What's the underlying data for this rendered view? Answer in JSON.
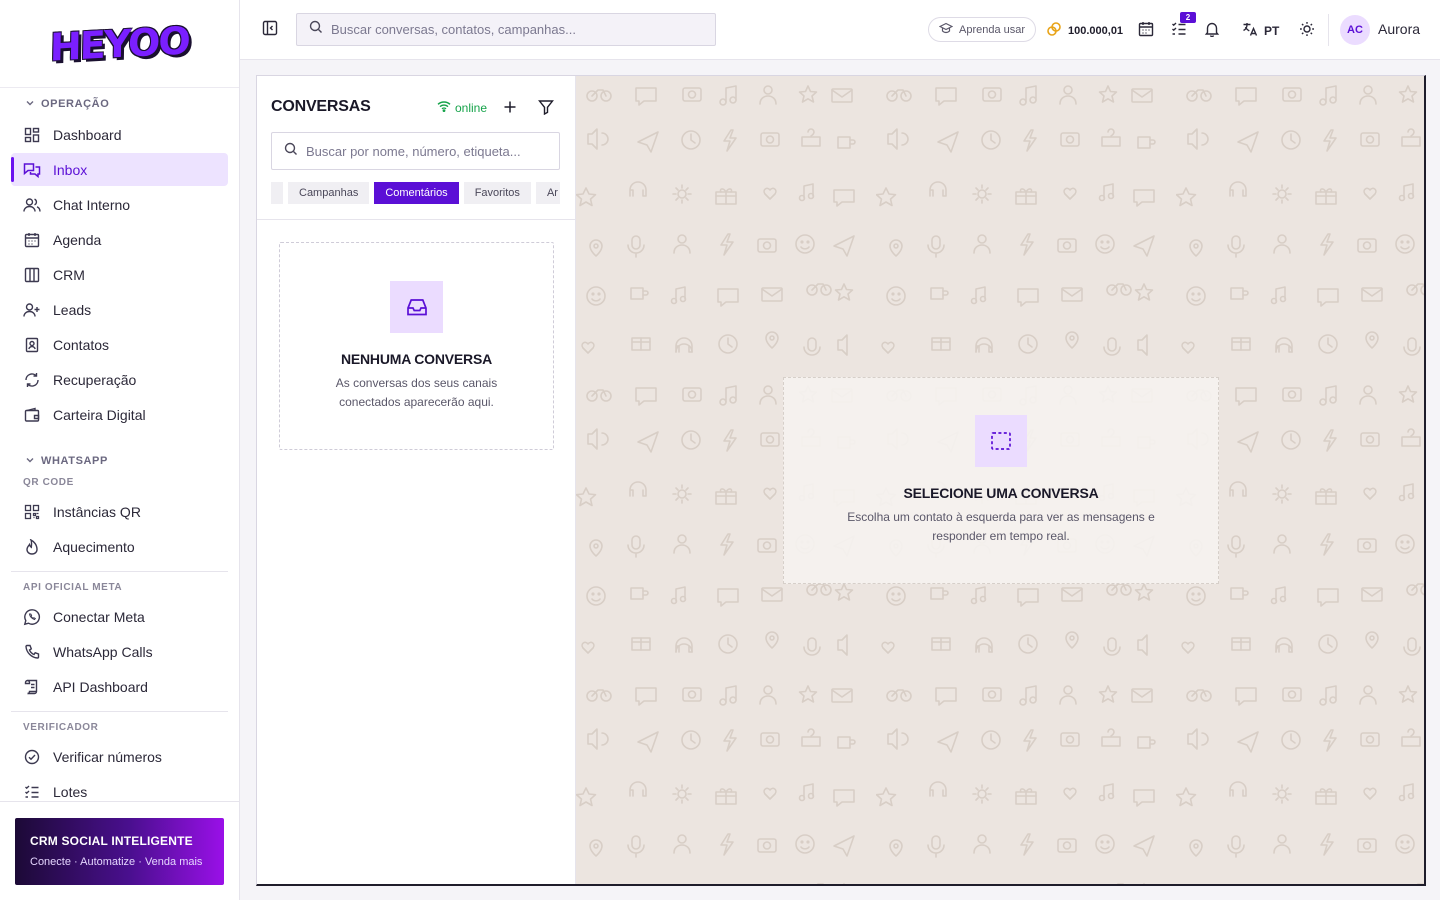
{
  "brand": {
    "logo_text": "HEYOO"
  },
  "sidebar": {
    "sections": {
      "operacao": "OPERAÇÃO",
      "whatsapp": "WHATSAPP",
      "qr_code": "QR CODE",
      "api_oficial": "API OFICIAL META",
      "verificador": "VERIFICADOR"
    },
    "items": {
      "dashboard": "Dashboard",
      "inbox": "Inbox",
      "chat_interno": "Chat Interno",
      "agenda": "Agenda",
      "crm": "CRM",
      "leads": "Leads",
      "contatos": "Contatos",
      "recuperacao": "Recuperação",
      "carteira": "Carteira Digital",
      "instancias_qr": "Instâncias QR",
      "aquecimento": "Aquecimento",
      "conectar_meta": "Conectar Meta",
      "whatsapp_calls": "WhatsApp Calls",
      "api_dashboard": "API Dashboard",
      "verificar_numeros": "Verificar números",
      "lotes": "Lotes"
    },
    "active_item": "inbox",
    "promo": {
      "title": "CRM SOCIAL INTELIGENTE",
      "subtitle": "Conecte · Automatize · Venda mais"
    }
  },
  "topbar": {
    "search_placeholder": "Buscar conversas, contatos, campanhas...",
    "learn_label": "Aprenda usar",
    "credits": "100.000,01",
    "tasks_badge": "2",
    "language": "PT",
    "user_initials": "AC",
    "user_name": "Aurora"
  },
  "conversations": {
    "title": "CONVERSAS",
    "status": "online",
    "search_placeholder": "Buscar por nome, número, etiqueta...",
    "tabs": [
      "Campanhas",
      "Comentários",
      "Favoritos",
      "Ar"
    ],
    "active_tab": 1,
    "empty": {
      "title": "NENHUMA CONVERSA",
      "subtitle": "As conversas dos seus canais conectados aparecerão aqui."
    }
  },
  "chat": {
    "empty": {
      "title": "SELECIONE UMA CONVERSA",
      "subtitle": "Escolha um contato à esquerda para ver as mensagens e responder em tempo real."
    }
  },
  "colors": {
    "accent": "#5b0fd6",
    "accent_light": "#ebdcff",
    "online": "#16a34a",
    "chat_bg": "#ece5e0"
  }
}
